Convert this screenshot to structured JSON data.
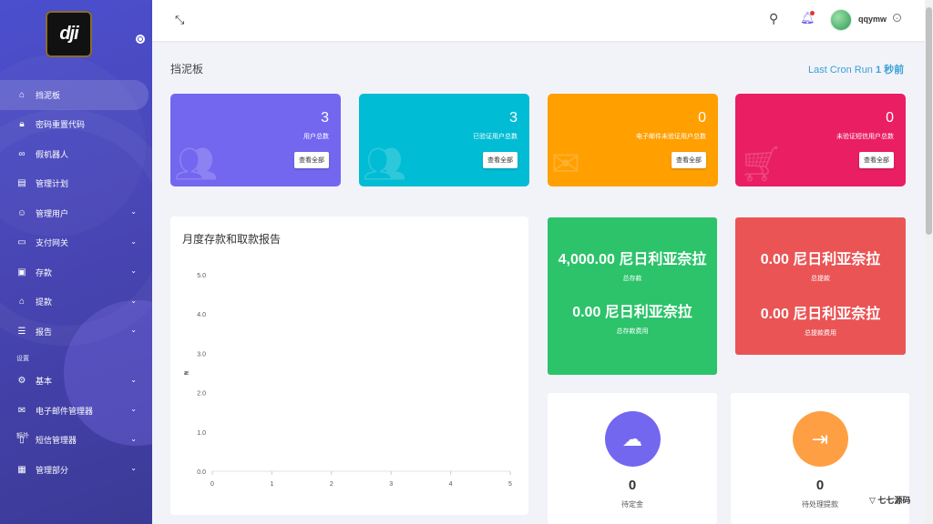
{
  "sidebar": {
    "logo_text": "dji",
    "items": [
      {
        "label": "挡泥板",
        "icon": "home-icon",
        "active": true
      },
      {
        "label": "密码重置代码",
        "icon": "lock-icon"
      },
      {
        "label": "假机器人",
        "icon": "link-icon"
      },
      {
        "label": "管理计划",
        "icon": "document-icon"
      },
      {
        "label": "管理用户",
        "icon": "users-icon",
        "chevron": true
      },
      {
        "label": "支付网关",
        "icon": "card-icon",
        "chevron": true
      },
      {
        "label": "存款",
        "icon": "wallet-icon",
        "chevron": true
      },
      {
        "label": "提款",
        "icon": "bank-icon",
        "chevron": true
      },
      {
        "label": "报告",
        "icon": "list-icon",
        "chevron": true
      }
    ],
    "section_settings": "设置",
    "settings_items": [
      {
        "label": "基本",
        "icon": "gear-icon",
        "chevron": true
      },
      {
        "label": "电子邮件管理器",
        "icon": "mail-icon",
        "chevron": true
      },
      {
        "label": "短信管理器",
        "icon": "phone-icon",
        "chevron": true
      },
      {
        "label": "管理部分",
        "icon": "section-icon",
        "chevron": true
      }
    ],
    "section_extra": "额外"
  },
  "topbar": {
    "username": "qqymw"
  },
  "header": {
    "title": "挡泥板",
    "cron_label": "Last Cron Run",
    "cron_value": "1 秒前"
  },
  "stats": [
    {
      "value": "3",
      "label": "用户总数",
      "button": "查看全部",
      "color": "#7367f0",
      "icon": "users-icon"
    },
    {
      "value": "3",
      "label": "已验证用户总数",
      "button": "查看全部",
      "color": "#00bcd4",
      "icon": "users-icon"
    },
    {
      "value": "0",
      "label": "电子邮件未验证用户总数",
      "button": "查看全部",
      "color": "#ff9f00",
      "icon": "mail-icon"
    },
    {
      "value": "0",
      "label": "未验证短信用户总数",
      "button": "查看全部",
      "color": "#ea1e63",
      "icon": "cart-icon"
    }
  ],
  "chart_panel": {
    "title": "月度存款和取款报告"
  },
  "chart_data": {
    "type": "line",
    "title": "月度存款和取款报告",
    "x": [
      0,
      1,
      2,
      3,
      4,
      5
    ],
    "xlim": [
      0,
      5
    ],
    "ylim": [
      0,
      5
    ],
    "yticks": [
      "0.0",
      "1.0",
      "2.0",
      "3.0",
      "4.0",
      "5.0"
    ],
    "xticks": [
      "0",
      "1",
      "2",
      "3",
      "4",
      "5"
    ],
    "ylabel": "₦",
    "series": []
  },
  "totals": {
    "deposit_amount": "4,000.00 尼日利亚奈拉",
    "deposit_label": "总存款",
    "deposit_fee_amount": "0.00 尼日利亚奈拉",
    "deposit_fee_label": "总存款费用",
    "withdraw_amount": "0.00 尼日利亚奈拉",
    "withdraw_label": "总提款",
    "withdraw_fee_amount": "0.00 尼日利亚奈拉",
    "withdraw_fee_label": "总提款费用"
  },
  "pending": [
    {
      "value": "0",
      "label": "待定金",
      "color": "#7367f0",
      "icon": "cloud-download-icon"
    },
    {
      "value": "0",
      "label": "待处理提款",
      "color": "#ff9f43",
      "icon": "exit-icon"
    }
  ],
  "watermark": {
    "text": "七七源码"
  }
}
